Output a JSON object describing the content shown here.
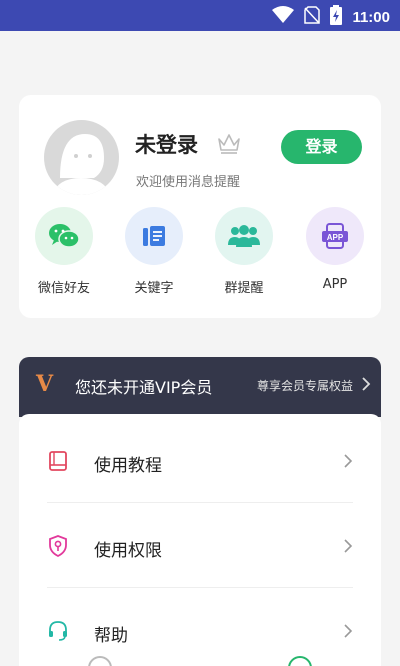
{
  "status_bar": {
    "time": "11:00"
  },
  "user": {
    "name": "未登录",
    "subtitle": "欢迎使用消息提醒",
    "login_label": "登录"
  },
  "quick_actions": [
    {
      "label": "微信好友",
      "icon": "wechat-icon",
      "color": "#2bc068"
    },
    {
      "label": "关键字",
      "icon": "keyword-icon",
      "color": "#3c7be0"
    },
    {
      "label": "群提醒",
      "icon": "group-icon",
      "color": "#2bb89a"
    },
    {
      "label": "APP",
      "icon": "app-icon",
      "color": "#7a55d6"
    }
  ],
  "vip": {
    "badge": "V",
    "title": "您还未开通VIP会员",
    "link": "尊享会员专属权益"
  },
  "menu": [
    {
      "label": "使用教程",
      "icon": "book-icon",
      "color": "#e2475f"
    },
    {
      "label": "使用权限",
      "icon": "shield-key-icon",
      "color": "#e2399b"
    },
    {
      "label": "帮助",
      "icon": "headset-icon",
      "color": "#22b8a6"
    }
  ],
  "colors": {
    "status_bar": "#3d49b2",
    "accent_green": "#27b66d",
    "vip_bg": "#34374a"
  }
}
